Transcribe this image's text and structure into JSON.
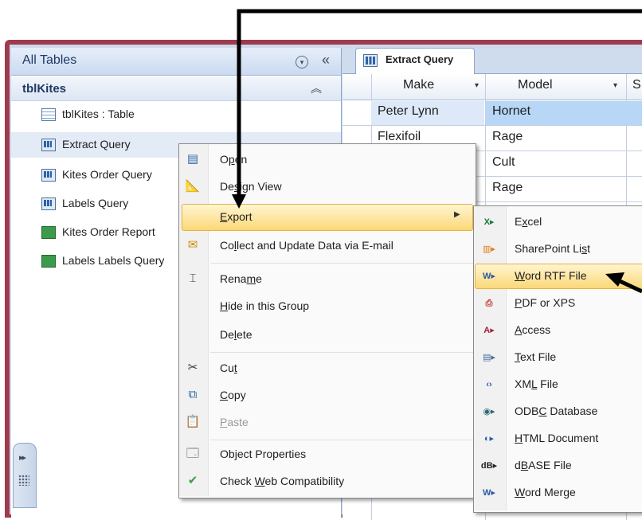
{
  "nav_pane": {
    "title": "All Tables",
    "menu_icon": "circle-chevron-down-icon",
    "collapse_icon": "double-chevron-left-icon",
    "group": {
      "name": "tblKites",
      "collapse_icon": "double-chevron-up-icon"
    },
    "items": [
      {
        "label": "tblKites : Table",
        "icon": "table-icon"
      },
      {
        "label": "Extract Query",
        "icon": "query-icon"
      },
      {
        "label": "Kites Order Query",
        "icon": "query-icon"
      },
      {
        "label": "Labels Query",
        "icon": "query-icon"
      },
      {
        "label": "Kites Order Report",
        "icon": "report-icon"
      },
      {
        "label": "Labels Labels Query",
        "icon": "report-icon"
      }
    ]
  },
  "document": {
    "tab_label": "Extract Query",
    "columns": [
      "Make",
      "Model",
      "S"
    ],
    "rows": [
      [
        "Peter Lynn",
        "Hornet"
      ],
      [
        "Flexifoil",
        "Rage"
      ],
      [
        "",
        "Cult"
      ],
      [
        "",
        "Rage"
      ]
    ]
  },
  "context_menu": {
    "items": [
      {
        "pre": "O",
        "ul": "p",
        "post": "en",
        "icon": "open-icon"
      },
      {
        "pre": "De",
        "ul": "s",
        "post": "ign View",
        "icon": "design-view-icon"
      },
      {
        "pre": "",
        "ul": "E",
        "post": "xport",
        "icon": ""
      },
      {
        "pre": "Co",
        "ul": "l",
        "post": "lect and Update Data via E-mail",
        "icon": "collect-data-icon"
      },
      {
        "pre": "Rena",
        "ul": "m",
        "post": "e",
        "icon": "rename-icon"
      },
      {
        "pre": "",
        "ul": "H",
        "post": "ide in this Group",
        "icon": ""
      },
      {
        "pre": "De",
        "ul": "l",
        "post": "ete",
        "icon": ""
      },
      {
        "pre": "Cu",
        "ul": "t",
        "post": "",
        "icon": "scissors-icon"
      },
      {
        "pre": "",
        "ul": "C",
        "post": "opy",
        "icon": "copy-icon"
      },
      {
        "pre": "",
        "ul": "P",
        "post": "aste",
        "icon": "paste-icon"
      },
      {
        "pre": "Ob",
        "ul": "j",
        "post": "ect Properties",
        "icon": "properties-icon"
      },
      {
        "pre": "Check ",
        "ul": "W",
        "post": "eb Compatibility",
        "icon": "web-check-icon"
      }
    ]
  },
  "export_submenu": {
    "items": [
      {
        "pre": "E",
        "ul": "x",
        "post": "cel",
        "icon": "excel-icon"
      },
      {
        "pre": "SharePoint Li",
        "ul": "s",
        "post": "t",
        "icon": "sharepoint-icon"
      },
      {
        "pre": "",
        "ul": "W",
        "post": "ord RTF File",
        "icon": "word-icon"
      },
      {
        "pre": "",
        "ul": "P",
        "post": "DF or XPS",
        "icon": "pdf-icon"
      },
      {
        "pre": "",
        "ul": "A",
        "post": "ccess",
        "icon": "access-icon"
      },
      {
        "pre": "",
        "ul": "T",
        "post": "ext File",
        "icon": "text-file-icon"
      },
      {
        "pre": "XM",
        "ul": "L",
        "post": " File",
        "icon": "xml-icon"
      },
      {
        "pre": "ODB",
        "ul": "C",
        "post": " Database",
        "icon": "odbc-icon"
      },
      {
        "pre": "",
        "ul": "H",
        "post": "TML Document",
        "icon": "html-icon"
      },
      {
        "pre": "d",
        "ul": "B",
        "post": "ASE File",
        "icon": "dbase-icon"
      },
      {
        "pre": "",
        "ul": "W",
        "post": "ord Merge",
        "icon": "word-merge-icon"
      }
    ]
  },
  "colors": {
    "frame": "#a03a4e",
    "highlight": "#fbd877",
    "selection": "#b8d6f5"
  }
}
